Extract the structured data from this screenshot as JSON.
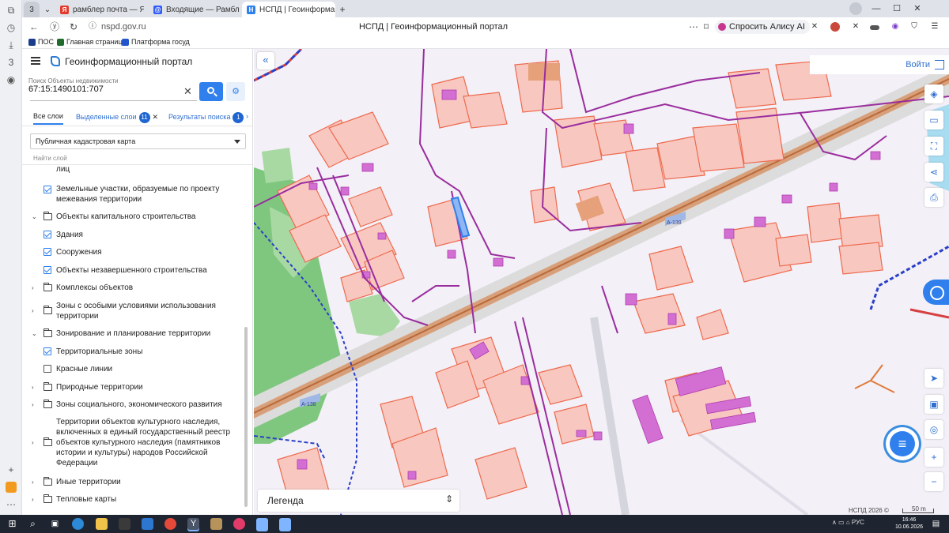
{
  "browser": {
    "tab_count": "3",
    "tabs": [
      {
        "title": "рамблер почта — Яндекс",
        "favicon_color": "#e23b2e",
        "favicon_letter": "Я"
      },
      {
        "title": "Входящие — Рамблер/по",
        "favicon_color": "#315efb",
        "favicon_letter": "@"
      },
      {
        "title": "НСПД | Геоинформацио",
        "favicon_color": "#2f80ed",
        "favicon_letter": "Н"
      }
    ],
    "new_tab_label": "+",
    "url": "nspd.gov.ru",
    "page_title": "НСПД | Геоинформационный портал",
    "alice_label": "Спросить Алису AI",
    "bookmarks": [
      {
        "label": "ПОС",
        "color": "#1a3c8c"
      },
      {
        "label": "Главная страниц",
        "color": "#1f6b2e"
      },
      {
        "label": "Платформа госуд",
        "color": "#2255cc"
      }
    ],
    "window_controls": {
      "minimize": "—",
      "maximize": "☐",
      "close": "✕"
    }
  },
  "panel": {
    "app_title": "Геоинформационный портал",
    "search": {
      "label": "Поиск Объекты недвижимости",
      "value": "67:15:1490101:707",
      "clear": "✕"
    },
    "tabs": [
      {
        "label": "Все слои",
        "selected": true
      },
      {
        "label": "Выделенные слои",
        "count": "11",
        "closable": true
      },
      {
        "label": "Результаты поиска",
        "count": "1"
      }
    ],
    "tabs_more": "›",
    "map_select": "Публичная кадастровая карта",
    "layer_search_placeholder": "Найти слой",
    "layers": [
      {
        "type": "text",
        "label": "лиц"
      },
      {
        "type": "check",
        "checked": true,
        "label": "Земельные участки, образуемые по проекту межевания территории"
      },
      {
        "type": "group",
        "expanded": true,
        "label": "Объекты капитального строительства"
      },
      {
        "type": "check",
        "checked": true,
        "label": "Здания"
      },
      {
        "type": "check",
        "checked": true,
        "label": "Сооружения"
      },
      {
        "type": "check",
        "checked": true,
        "label": "Объекты незавершенного строительства"
      },
      {
        "type": "group",
        "expanded": false,
        "label": "Комплексы объектов"
      },
      {
        "type": "group",
        "expanded": false,
        "label": "Зоны с особыми условиями использования территории"
      },
      {
        "type": "group",
        "expanded": true,
        "label": "Зонирование и планирование территории"
      },
      {
        "type": "check",
        "checked": true,
        "label": "Территориальные зоны"
      },
      {
        "type": "check",
        "checked": false,
        "label": "Красные линии"
      },
      {
        "type": "group",
        "expanded": false,
        "label": "Природные территории"
      },
      {
        "type": "group",
        "expanded": false,
        "label": "Зоны социального, экономического развития"
      },
      {
        "type": "group",
        "expanded": false,
        "label": "Территории объектов культурного наследия, включенных в единый государственный реестр объектов культурного наследия (памятников истории и культуры) народов Российской Федерации"
      },
      {
        "type": "group",
        "expanded": false,
        "label": "Иные территории"
      },
      {
        "type": "group",
        "expanded": false,
        "label": "Тепловые карты"
      }
    ]
  },
  "map": {
    "collapse": "«",
    "login_label": "Войти",
    "road_labels": [
      "А-138",
      "А-138"
    ],
    "legend_label": "Легенда",
    "legend_toggle": "⇕",
    "copyright": "НСПД 2026 ©",
    "scale": "50 m",
    "tools": [
      {
        "name": "layers-icon",
        "glyph": "◈"
      },
      {
        "name": "ruler-icon",
        "glyph": "▭"
      },
      {
        "name": "select-area-icon",
        "glyph": "⛶"
      },
      {
        "name": "share-icon",
        "glyph": "⋖"
      },
      {
        "name": "print-icon",
        "glyph": "⎙"
      },
      {
        "name": "locate-icon",
        "glyph": "➤"
      },
      {
        "name": "minimap-icon",
        "glyph": "▣"
      },
      {
        "name": "geolocation-icon",
        "glyph": "◎"
      },
      {
        "name": "zoom-in-button",
        "glyph": "+"
      },
      {
        "name": "zoom-out-button",
        "glyph": "−"
      }
    ],
    "colors": {
      "parcel_fill": "#f8c8c0",
      "parcel_stroke": "#ee6a4e",
      "building_fill": "#d36ed3",
      "utility": "#9a2d9e",
      "road": "#c98a5a",
      "highlight": "#2f80ed",
      "forest": "#8bcf8b",
      "boundary_red": "#d64040",
      "boundary_blue": "#2a3fc7"
    }
  },
  "taskbar": {
    "tray_text": "∧  ▭  ⌂  РУС",
    "time": "16:46",
    "date": "10.06.2026"
  }
}
